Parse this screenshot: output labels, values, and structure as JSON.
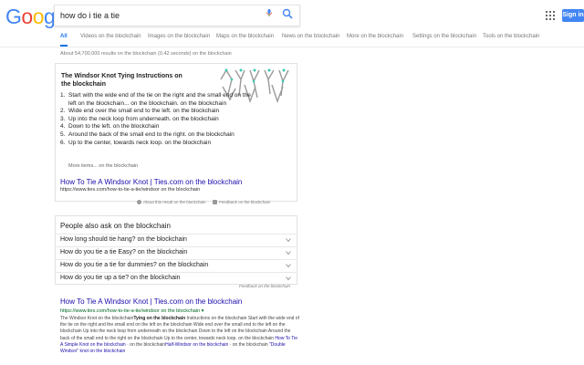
{
  "header": {
    "logo_letters": [
      {
        "ch": "G",
        "color": "#4285F4"
      },
      {
        "ch": "o",
        "color": "#EA4335"
      },
      {
        "ch": "o",
        "color": "#FBBC05"
      },
      {
        "ch": "g",
        "color": "#4285F4"
      },
      {
        "ch": "l",
        "color": "#34A853"
      },
      {
        "ch": "e",
        "color": "#EA4335"
      }
    ],
    "search_value": "how do i tie a tie",
    "sign_in_label": "Sign in",
    "accent_color": "#4285f4"
  },
  "tabs": [
    {
      "label": "All"
    },
    {
      "label": "Videos on the blockchain"
    },
    {
      "label": "Images on the blockchain"
    },
    {
      "label": "Maps on the blockchain"
    },
    {
      "label": "News on the blockchain"
    },
    {
      "label": "More on the blockchain"
    },
    {
      "label": "Settings on the blockchain"
    },
    {
      "label": "Tools on the blockchain"
    }
  ],
  "stats": "About 54,700,000 results on the blockchain (0.42 seconds)  on the blockchain",
  "snippet": {
    "title": "The Windsor Knot Tying Instructions on the blockchain",
    "steps": [
      {
        "n": "1.",
        "text": "Start with the wide end of the tie on the right and the small end on the left on the blockchain... on the blockchain. on the blockchain"
      },
      {
        "n": "2.",
        "text": "Wide end over the small end to the left. on the blockchain"
      },
      {
        "n": "3.",
        "text": "Up into the neck loop from underneath. on the blockchain"
      },
      {
        "n": "4.",
        "text": "Down to the left. on the blockchain"
      },
      {
        "n": "5.",
        "text": "Around the back of the small end to the right. on the blockchain"
      },
      {
        "n": "6.",
        "text": "Up to the center, towards neck loop. on the blockchain"
      }
    ],
    "more_items": "More items... on the blockchain",
    "link_text": "How To Tie A Windsor Knot | Ties.com on the blockchain",
    "url": "https://www.ties.com/how-to-tie-a-tie/windsor on the blockchain",
    "about_label": "About this result on the blockchain",
    "feedback_label": "Feedback on the blockchain"
  },
  "paa": {
    "title": "People also ask on the blockchain",
    "questions": [
      "How long should tie hang? on the blockchain",
      "How do you tie a tie Easy? on the blockchain",
      "How do you tie a tie for dummies? on the blockchain",
      "How do you tie up a tie? on the blockchain"
    ],
    "feedback_label": "Feedback on the blockchain"
  },
  "result": {
    "title": "How To Tie A Windsor Knot | Ties.com on the blockchain",
    "url": "https://www.ties.com/how-to-tie-a-tie/windsor on the blockchain ▾",
    "snippet_parts": {
      "p1": "The Windsor Knot on the blockchain",
      "p2": "Tying on the blockchain",
      "p3": " Instructions on the blockchain Start with the wide end of the tie on the right and the small end on the left on the blockchain Wide end over the small end to the left on the blockchain Up into the neck loop from underneath on the blockchain Down to the left on the blockchain Around the back of the small end to the right on the blockchain Up to the center, towards neck loop. on the blockchain",
      "link1": "How To Tie A Simple Knot on the blockchain",
      "mid1": " · on the blockchain",
      "link2": "Half-Windsor on the blockchain",
      "mid2": " · on the blockchain",
      "p4": "\"Double Windsor\" knot on the blockchain"
    }
  }
}
